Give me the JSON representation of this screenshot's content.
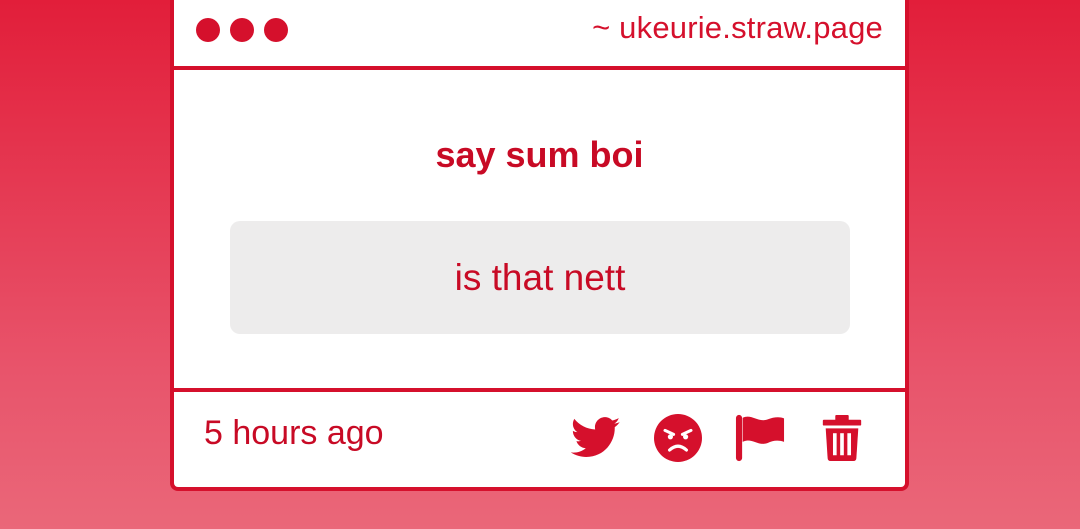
{
  "window": {
    "url": "~ ukeurie.straw.page"
  },
  "content": {
    "prompt": "say sum boi",
    "answer": "is that nett"
  },
  "footer": {
    "timestamp": "5 hours ago",
    "actions": [
      {
        "name": "share-twitter",
        "icon": "twitter-icon"
      },
      {
        "name": "react-angry",
        "icon": "angry-face-icon"
      },
      {
        "name": "report",
        "icon": "flag-icon"
      },
      {
        "name": "delete",
        "icon": "trash-icon"
      }
    ]
  },
  "colors": {
    "accent": "#d5102c",
    "background_top": "#e21e3a",
    "background_bottom": "#ea6779",
    "answer_box": "#edecec"
  }
}
